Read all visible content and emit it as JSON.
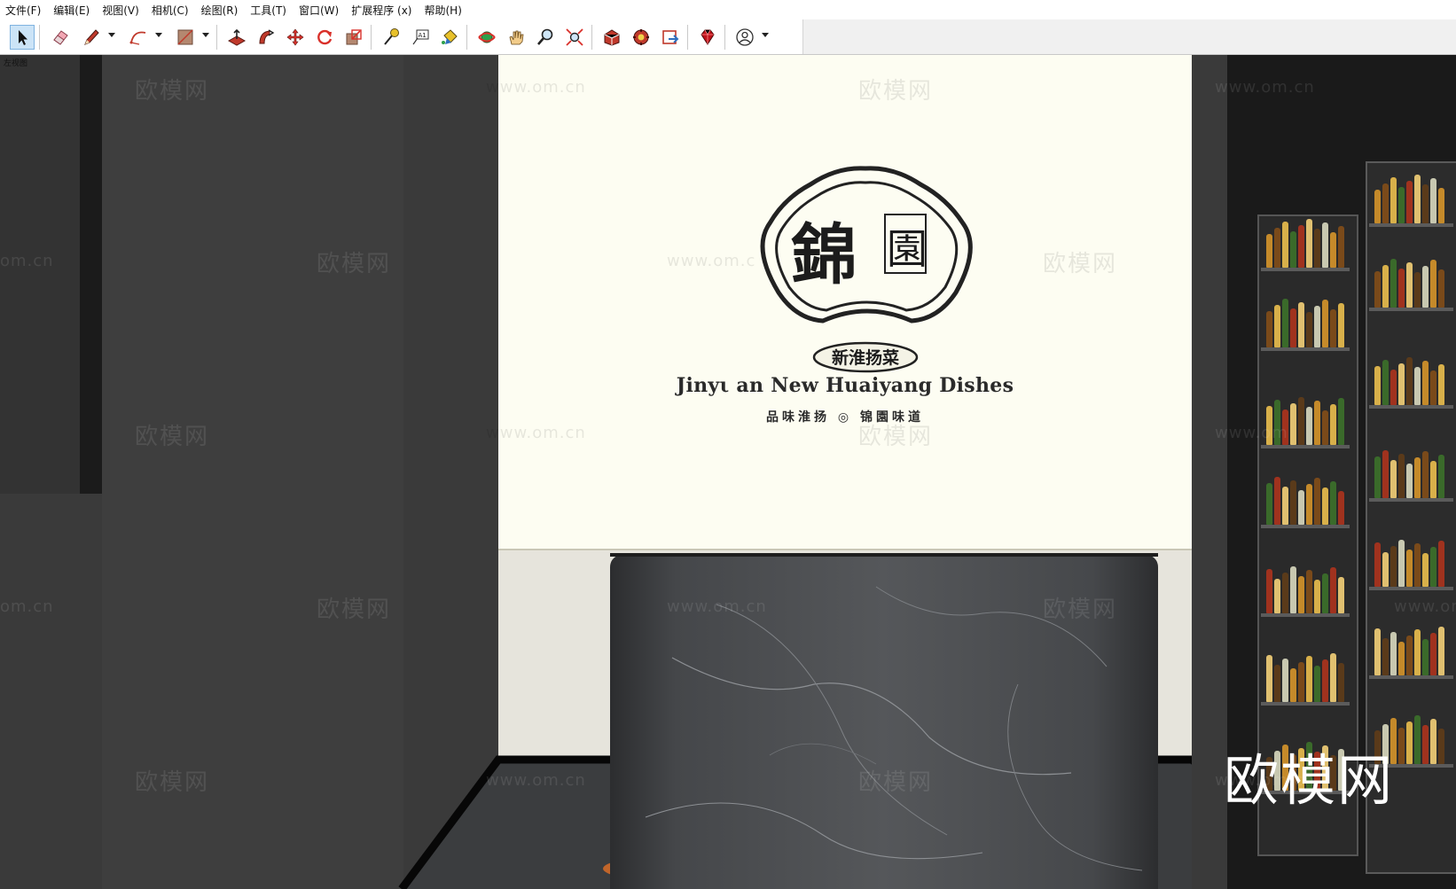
{
  "menu": [
    "文件(F)",
    "编辑(E)",
    "视图(V)",
    "相机(C)",
    "绘图(R)",
    "工具(T)",
    "窗口(W)",
    "扩展程序 (x)",
    "帮助(H)"
  ],
  "toolbar": {
    "tools": [
      {
        "name": "select-tool-icon"
      },
      {
        "name": "eraser-tool-icon"
      },
      {
        "name": "pencil-line-tool-icon"
      },
      {
        "name": "arc-tool-icon"
      },
      {
        "name": "rectangle-tool-icon"
      },
      {
        "name": "push-pull-tool-icon"
      },
      {
        "name": "follow-me-tool-icon"
      },
      {
        "name": "move-tool-icon"
      },
      {
        "name": "rotate-tool-icon"
      },
      {
        "name": "scale-tool-icon"
      },
      {
        "name": "tape-measure-tool-icon"
      },
      {
        "name": "text-tool-icon"
      },
      {
        "name": "paint-bucket-tool-icon"
      },
      {
        "name": "orbit-tool-icon"
      },
      {
        "name": "pan-tool-icon"
      },
      {
        "name": "zoom-tool-icon"
      },
      {
        "name": "zoom-extents-tool-icon"
      },
      {
        "name": "warehouse-icon"
      },
      {
        "name": "extension-warehouse-icon"
      },
      {
        "name": "send-to-layout-icon"
      },
      {
        "name": "ruby-console-icon"
      },
      {
        "name": "account-icon"
      }
    ],
    "text_tool_glyph": "A1"
  },
  "viewport": {
    "view_label": "左视图",
    "sign": {
      "logo_char_main": "錦",
      "logo_char_seal": "園",
      "badge_text": "新淮扬菜",
      "english_name": "Jinyι an New Huaiyang Dishes",
      "slogan": "品味淮扬 ◎ 锦園味道"
    },
    "watermark_cn": "欧模网",
    "watermark_url": "www.om.cn",
    "watermark_url_partial": "om.cn",
    "watermark_url_cut": "www.om",
    "watermark_url_cut2": "www.om.c",
    "watermark_url_cut3": "www.om.cn",
    "big_watermark": "欧模网"
  },
  "colors": {
    "accent_select": "#cce4f7",
    "sign_bg": "#fdfdf2",
    "wall_dark": "#3a3a3a",
    "marble": "#4a4c4f"
  }
}
